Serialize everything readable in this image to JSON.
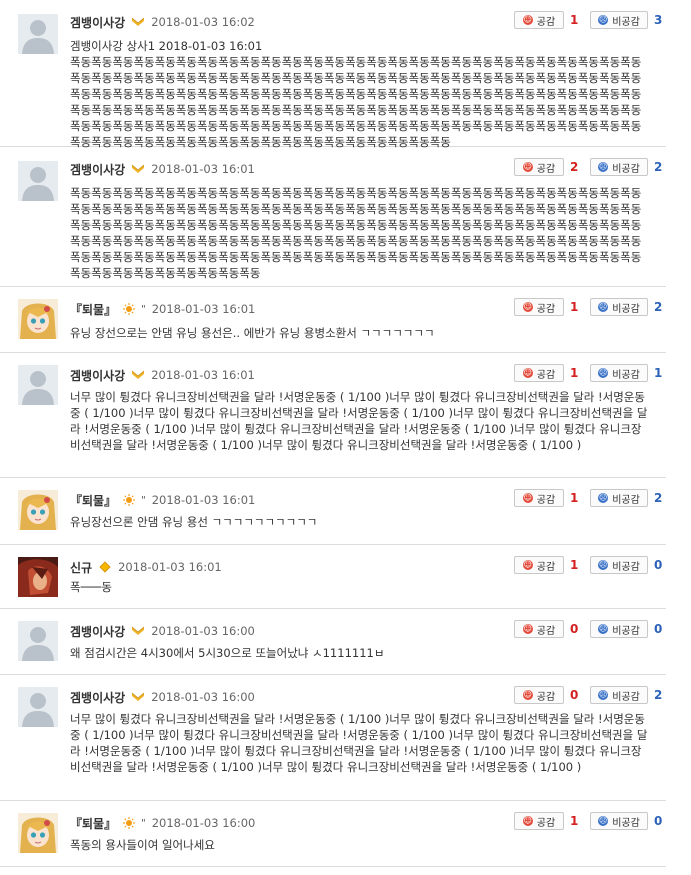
{
  "labels": {
    "like": "공감",
    "dislike": "비공감"
  },
  "comments": [
    {
      "nick": "겜뱅이사강",
      "grade": "chevron",
      "time": "2018-01-03 16:02",
      "avatar": "default",
      "likes": "1",
      "dislikes": "3",
      "lines": [
        "겜뱅이사강 상사1 2018-01-03 16:01",
        "폭동폭동폭동폭동폭동폭동폭동폭동폭동폭동폭동폭동폭동폭동폭동폭동폭동폭동폭동폭동폭동폭동폭동폭동폭동폭동폭동폭동폭동폭동폭동폭동폭동폭동폭동폭동폭동폭동폭동폭동폭동폭동폭동폭동폭동폭동폭동폭동폭동폭동폭동폭동폭동폭동폭동폭동폭동폭동폭동폭동폭동폭동폭동폭동폭동폭동폭동폭동폭동폭동폭동폭동폭동폭동폭동폭동폭동폭동폭동폭동폭동폭동폭동폭동폭동폭동폭동폭동폭동폭동폭동폭동폭동폭동폭동폭동폭동폭동폭동폭동폭동폭동폭동폭동폭동폭동폭동폭동폭동폭동폭동폭동폭동폭동폭동폭동폭동폭동폭동폭동폭동폭동폭동폭동폭동폭동폭동폭동폭동폭동폭동폭동폭동폭동폭동폭동폭동폭동폭동폭동폭동폭동폭동폭동폭동폭동폭동폭동폭동폭동폭동폭동폭동"
      ]
    },
    {
      "nick": "겜뱅이사강",
      "grade": "chevron",
      "time": "2018-01-03 16:01",
      "avatar": "default",
      "likes": "2",
      "dislikes": "2",
      "lines": [
        "폭동폭동폭동폭동폭동폭동폭동폭동폭동폭동폭동폭동폭동폭동폭동폭동폭동폭동폭동폭동폭동폭동폭동폭동폭동폭동폭동폭동폭동폭동폭동폭동폭동폭동폭동폭동폭동폭동폭동폭동폭동폭동폭동폭동폭동폭동폭동폭동폭동폭동폭동폭동폭동폭동폭동폭동폭동폭동폭동폭동폭동폭동폭동폭동폭동폭동폭동폭동폭동폭동폭동폭동폭동폭동폭동폭동폭동폭동폭동폭동폭동폭동폭동폭동폭동폭동폭동폭동폭동폭동폭동폭동폭동폭동폭동폭동폭동폭동폭동폭동폭동폭동폭동폭동폭동폭동폭동폭동폭동폭동폭동폭동폭동폭동폭동폭동폭동폭동폭동폭동폭동폭동폭동폭동폭동폭동폭동폭동폭동폭동폭동폭동폭동폭동폭동폭동폭동폭동폭동폭동폭동폭동폭동폭동"
      ]
    },
    {
      "nick": "『퇴물』",
      "grade": "sun",
      "quote": "\"",
      "time": "2018-01-03 16:01",
      "avatar": "anime",
      "likes": "1",
      "dislikes": "2",
      "lines": [
        "유닝 장선으로는 안댐 유닝 용선은.. 에반가 유닝 용병소환서 ㄱㄱㄱㄱㄱㄱㄱ"
      ]
    },
    {
      "nick": "겜뱅이사강",
      "grade": "chevron",
      "time": "2018-01-03 16:01",
      "avatar": "default",
      "likes": "1",
      "dislikes": "1",
      "lines": [
        "너무 많이 튕겼다 유니크장비선택권을 달라 !서명운동중 ( 1/100 )너무 많이 튕겼다 유니크장비선택권을 달라 !서명운동중 ( 1/100 )너무 많이 튕겼다 유니크장비선택권을 달라 !서명운동중 ( 1/100 )너무 많이 튕겼다 유니크장비선택권을 달라 !서명운동중 ( 1/100 )너무 많이 튕겼다 유니크장비선택권을 달라 !서명운동중 ( 1/100 )너무 많이 튕겼다 유니크장비선택권을 달라 !서명운동중 ( 1/100 )너무 많이 튕겼다 유니크장비선택권을 달라 !서명운동중 ( 1/100 )"
      ]
    },
    {
      "nick": "『퇴물』",
      "grade": "sun",
      "quote": "\"",
      "time": "2018-01-03 16:01",
      "avatar": "anime",
      "likes": "1",
      "dislikes": "2",
      "lines": [
        "유닝장선으론 안댐 유닝 용선 ㄱㄱㄱㄱㄱㄱㄱㄱㄱㄱ"
      ]
    },
    {
      "nick": "신규",
      "grade": "diamond",
      "time": "2018-01-03 16:01",
      "avatar": "red",
      "likes": "1",
      "dislikes": "0",
      "lines": [
        "폭───동"
      ]
    },
    {
      "nick": "겜뱅이사강",
      "grade": "chevron",
      "time": "2018-01-03 16:00",
      "avatar": "default",
      "likes": "0",
      "dislikes": "0",
      "lines": [
        "왜 점검시간은 4시30에서 5시30으로 또늘어났냐 ㅅ1111111ㅂ"
      ]
    },
    {
      "nick": "겜뱅이사강",
      "grade": "chevron",
      "time": "2018-01-03 16:00",
      "avatar": "default",
      "likes": "0",
      "dislikes": "2",
      "lines": [
        "너무 많이 튕겼다 유니크장비선택권을 달라 !서명운동중 ( 1/100 )너무 많이 튕겼다 유니크장비선택권을 달라 !서명운동중 ( 1/100 )너무 많이 튕겼다 유니크장비선택권을 달라 !서명운동중 ( 1/100 )너무 많이 튕겼다 유니크장비선택권을 달라 !서명운동중 ( 1/100 )너무 많이 튕겼다 유니크장비선택권을 달라 !서명운동중 ( 1/100 )너무 많이 튕겼다 유니크장비선택권을 달라 !서명운동중 ( 1/100 )너무 많이 튕겼다 유니크장비선택권을 달라 !서명운동중 ( 1/100 )"
      ]
    },
    {
      "nick": "『퇴물』",
      "grade": "sun",
      "quote": "\"",
      "time": "2018-01-03 16:00",
      "avatar": "anime",
      "likes": "1",
      "dislikes": "0",
      "lines": [
        "폭동의 용사들이여 일어나세요"
      ]
    }
  ]
}
